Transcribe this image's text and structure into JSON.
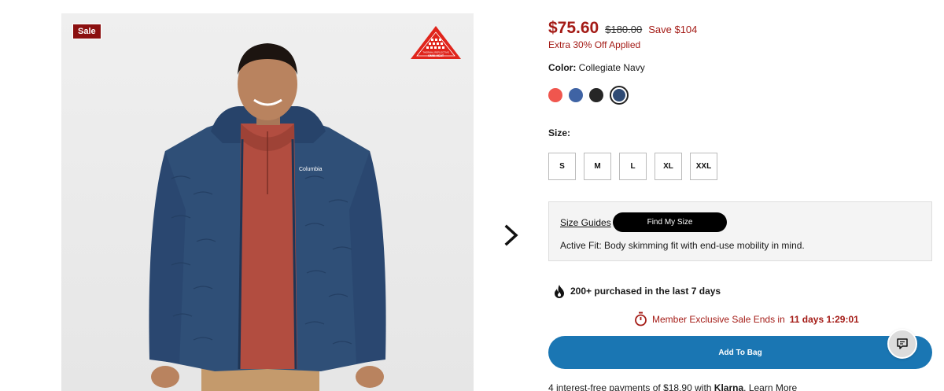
{
  "gallery": {
    "badge": "Sale",
    "logo_lines": [
      "THERMAL REFLECTIVE",
      "OMNI-HEAT"
    ],
    "brand_on_jacket": "Columbia"
  },
  "price": {
    "current": "$75.60",
    "original": "$180.00",
    "save": "Save $104",
    "promo": "Extra 30% Off Applied"
  },
  "color": {
    "label": "Color:",
    "selected": "Collegiate Navy",
    "swatches": [
      {
        "name": "coral",
        "hex": "#f0564e"
      },
      {
        "name": "blue",
        "hex": "#3f63a4"
      },
      {
        "name": "black",
        "hex": "#262626"
      },
      {
        "name": "collegiate-navy",
        "hex": "#2e4a74"
      }
    ]
  },
  "size": {
    "label": "Size:",
    "options": [
      "S",
      "M",
      "L",
      "XL",
      "XXL"
    ]
  },
  "fit": {
    "size_guides": "Size Guides",
    "find_my_size": "Find My Size",
    "description": "Active Fit: Body skimming fit with end-use mobility in mind."
  },
  "social_proof": {
    "text": "200+ purchased in the last 7 days"
  },
  "countdown": {
    "prefix": "Member Exclusive Sale Ends in",
    "time": "11 days 1:29:01"
  },
  "cart": {
    "add_label": "Add To Bag"
  },
  "klarna": {
    "prefix": "4 interest-free payments of $18.90 with",
    "brand": "Klarna",
    "suffix": ". Learn More"
  },
  "colors": {
    "sale_red": "#a41b16",
    "button_blue": "#1a76b3"
  }
}
